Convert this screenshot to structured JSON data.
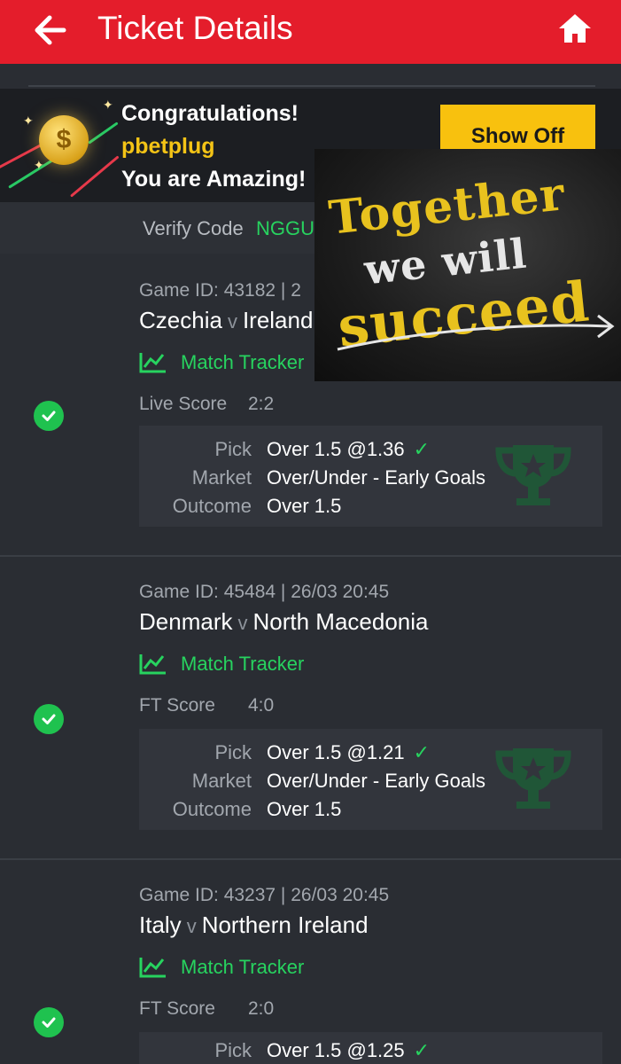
{
  "header": {
    "title": "Ticket Details",
    "back_icon": "arrow-left-icon",
    "home_icon": "home-icon"
  },
  "banner": {
    "line1": "Congratulations!",
    "username": "pbetplug",
    "line2": "You are Amazing!",
    "button": "Show Off",
    "coin_symbol": "$"
  },
  "verify": {
    "label": "Verify Code",
    "code": "NGGU"
  },
  "overlay_image": {
    "line1": "Together",
    "line2": "we will",
    "line3": "succeed"
  },
  "labels": {
    "pick": "Pick",
    "market": "Market",
    "outcome": "Outcome",
    "tracker": "Match Tracker",
    "vs": "v"
  },
  "bets": [
    {
      "game_id": "Game ID: 43182 | 2",
      "home": "Czechia",
      "away": "Ireland",
      "score_label": "Live Score",
      "score": "2:2",
      "pick": "Over 1.5 @1.36",
      "market": "Over/Under - Early Goals",
      "outcome": "Over 1.5"
    },
    {
      "game_id": "Game ID: 45484 | 26/03 20:45",
      "home": "Denmark",
      "away": "North Macedonia",
      "score_label": "FT Score",
      "score": "4:0",
      "pick": "Over 1.5 @1.21",
      "market": "Over/Under - Early Goals",
      "outcome": "Over 1.5"
    },
    {
      "game_id": "Game ID: 43237 | 26/03 20:45",
      "home": "Italy",
      "away": "Northern Ireland",
      "score_label": "FT Score",
      "score": "2:0",
      "pick": "Over 1.5 @1.25"
    }
  ],
  "colors": {
    "brand_red": "#e41d2b",
    "win_green": "#27d35f",
    "gold": "#f3c316",
    "bg": "#2a2d33"
  }
}
